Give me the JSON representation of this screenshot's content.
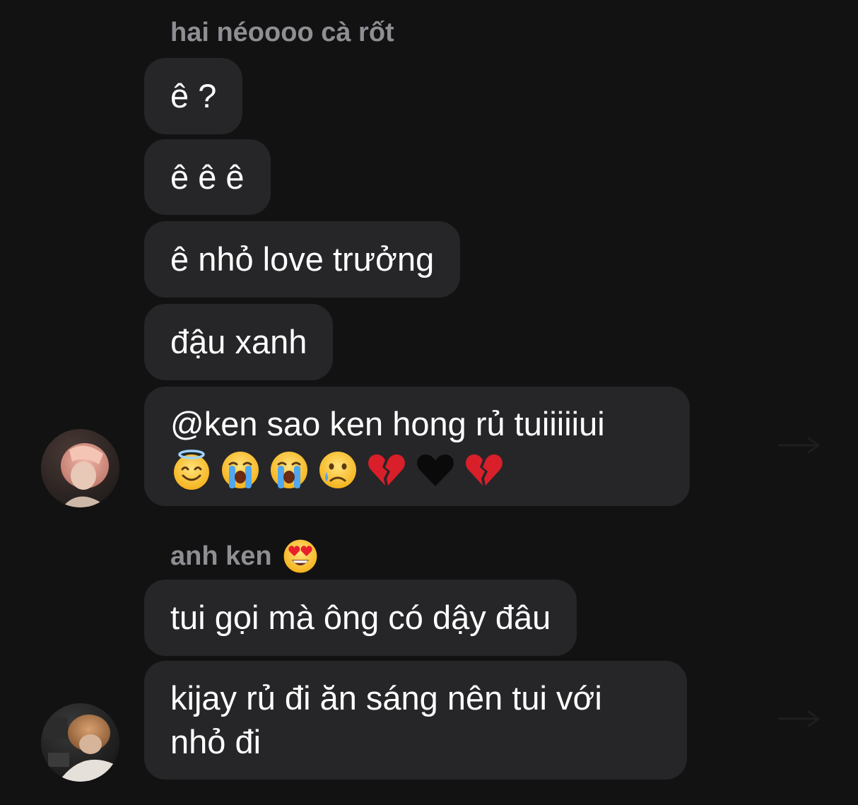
{
  "groups": [
    {
      "sender": "hai néoooo cà rốt",
      "messages": [
        {
          "text": "ê ?"
        },
        {
          "text": "ê ê ê"
        },
        {
          "text": "ê nhỏ love trưởng"
        },
        {
          "text": "đậu xanh"
        },
        {
          "text": "@ken sao ken hong rủ tuiiiiiui",
          "emojis": [
            "smiling-face-with-halo",
            "loudly-crying-face",
            "loudly-crying-face",
            "crying-face",
            "broken-heart",
            "black-heart",
            "broken-heart"
          ]
        }
      ]
    },
    {
      "sender": "anh ken",
      "sender_emoji": "smiling-face-with-heart-eyes",
      "messages": [
        {
          "text": "tui gọi mà ông có dậy đâu"
        },
        {
          "text": "kijay rủ đi ăn sáng nên tui với",
          "text_line2": "nhỏ đi"
        }
      ]
    }
  ],
  "colors": {
    "background": "#121213",
    "bubble": "#262628",
    "sender_name": "#8e8e93",
    "message_text": "#ffffff"
  }
}
